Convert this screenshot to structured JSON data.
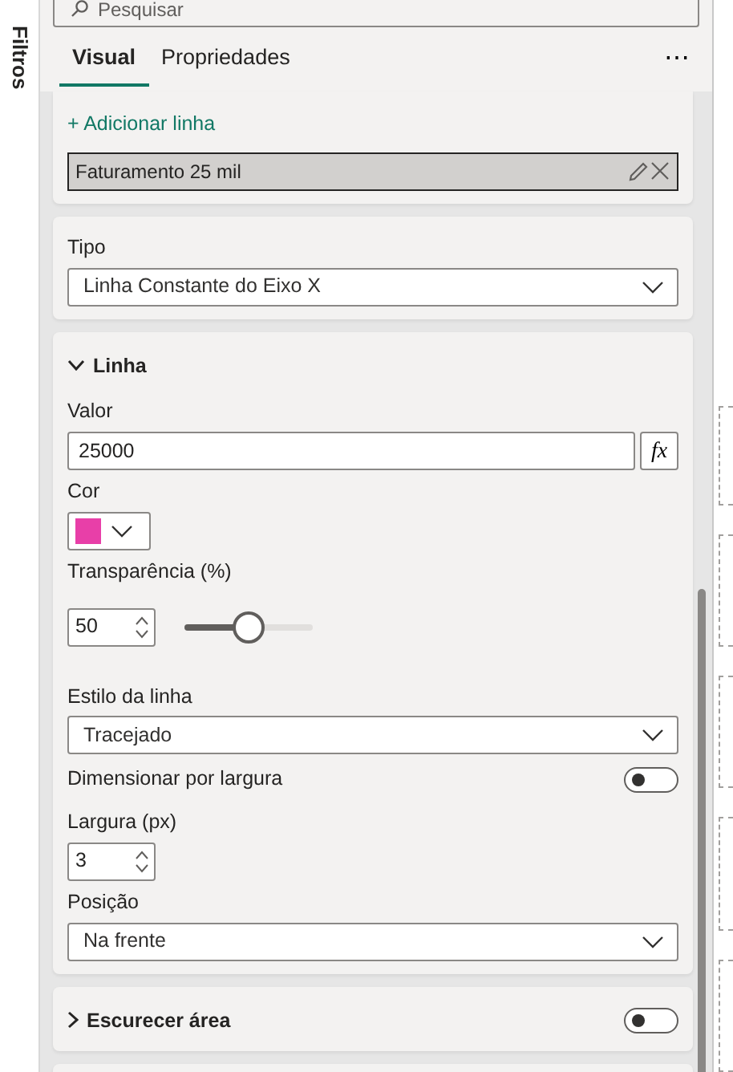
{
  "sidebar_tab": {
    "label": "Filtros"
  },
  "search": {
    "placeholder": "Pesquisar"
  },
  "tabs": [
    {
      "label": "Visual",
      "selected": true
    },
    {
      "label": "Propriedades",
      "selected": false
    }
  ],
  "more_button": "⋯",
  "cards": [
    {
      "kind": "lines",
      "add_label": "+ Adicionar linha",
      "items": [
        {
          "label": "Faturamento 25 mil",
          "selected": true
        }
      ]
    },
    {
      "kind": "fields",
      "fields": [
        {
          "kind": "dropdown",
          "label": "Tipo",
          "value": "Linha Constante do Eixo X"
        }
      ]
    },
    {
      "kind": "section",
      "title": "Linha",
      "expanded": true,
      "fields": [
        {
          "kind": "formula_input",
          "label": "Valor",
          "value": "25000",
          "button": "fx"
        },
        {
          "kind": "color",
          "label": "Cor",
          "color": "#e83fa8"
        },
        {
          "kind": "slider",
          "label": "Transparência (%)",
          "value": "50",
          "level": 0.5
        },
        {
          "kind": "dropdown",
          "label": "Estilo da linha",
          "value": "Tracejado"
        },
        {
          "kind": "toggle",
          "label": "Dimensionar por largura",
          "on": false
        },
        {
          "kind": "spin",
          "label": "Largura (px)",
          "value": "3"
        },
        {
          "kind": "dropdown",
          "label": "Posição",
          "value": "Na frente"
        }
      ]
    },
    {
      "kind": "section",
      "title": "Escurecer área",
      "expanded": false,
      "toggle": {
        "on": false
      }
    }
  ]
}
